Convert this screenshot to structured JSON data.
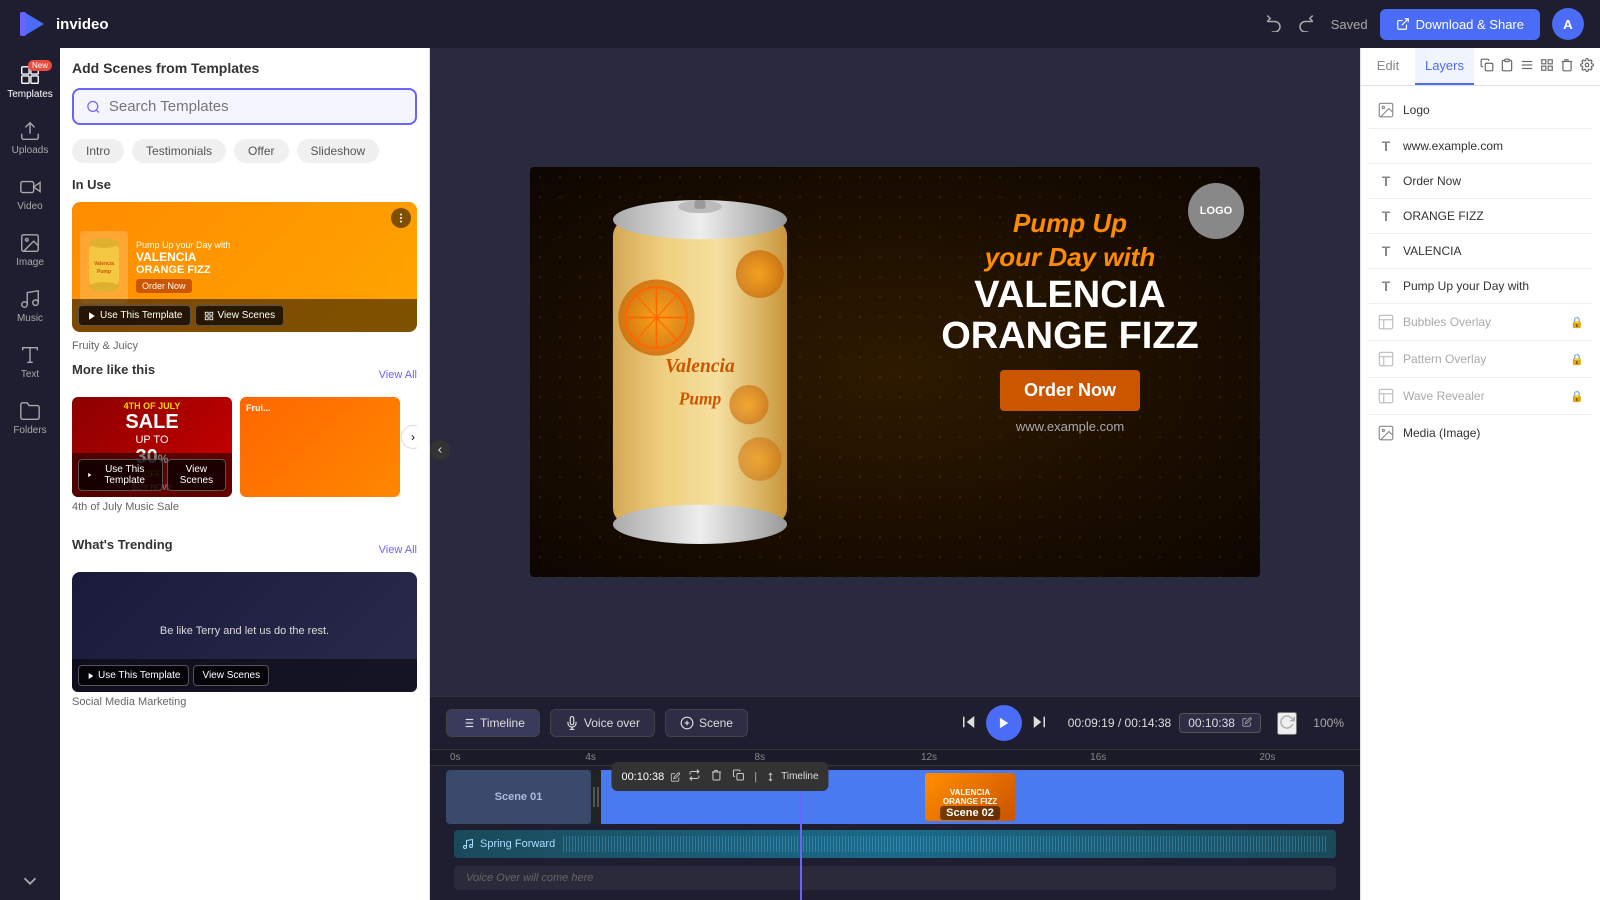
{
  "app": {
    "name": "invideo",
    "saved_status": "Saved"
  },
  "topbar": {
    "download_label": "Download & Share",
    "avatar_label": "A"
  },
  "sidebar_icons": [
    {
      "id": "templates",
      "label": "Templates",
      "badge": "New"
    },
    {
      "id": "uploads",
      "label": "Uploads"
    },
    {
      "id": "video",
      "label": "Video"
    },
    {
      "id": "image",
      "label": "Image"
    },
    {
      "id": "music",
      "label": "Music"
    },
    {
      "id": "text",
      "label": "Text"
    },
    {
      "id": "folders",
      "label": "Folders"
    },
    {
      "id": "more",
      "label": ""
    }
  ],
  "sidebar": {
    "header": "Add Scenes from Templates",
    "search_placeholder": "Search Templates",
    "filters": [
      "Intro",
      "Testimonials",
      "Offer",
      "Slideshow"
    ],
    "in_use_label": "In Use",
    "template_name": "Fruity & Juicy",
    "use_template_btn": "Use This Template",
    "view_scenes_btn": "View Scenes",
    "more_like_label": "More like this",
    "view_all_label": "View All",
    "sale_template_name": "4th of July Music Sale",
    "trending_label": "What's Trending",
    "trending_view_all": "View All",
    "trending_template_name": "Social Media Marketing",
    "trending_desc": "Be like Terry and let us do the rest.",
    "trending_view_scenes": "View Scenes",
    "trending_use_template": "Use This Template"
  },
  "canvas": {
    "logo_text": "LOGO",
    "headline1": "Pump Up",
    "headline2": "your Day with",
    "brand1": "VALENCIA",
    "brand2": "ORANGE FIZZ",
    "cta_btn": "Order Now",
    "website": "www.example.com",
    "can_label": "Valencia Pump"
  },
  "right_panel": {
    "edit_tab": "Edit",
    "layers_tab": "Layers",
    "layers": [
      {
        "id": "logo",
        "name": "Logo",
        "type": "image",
        "locked": false
      },
      {
        "id": "website",
        "name": "www.example.com",
        "type": "text",
        "locked": false
      },
      {
        "id": "order",
        "name": "Order Now",
        "type": "text",
        "locked": false
      },
      {
        "id": "orange_fizz",
        "name": "ORANGE FIZZ",
        "type": "text",
        "locked": false
      },
      {
        "id": "valencia",
        "name": "VALENCIA",
        "type": "text",
        "locked": false
      },
      {
        "id": "pump_day",
        "name": "Pump Up your Day with",
        "type": "text",
        "locked": false
      },
      {
        "id": "bubbles",
        "name": "Bubbles Overlay",
        "type": "overlay",
        "locked": true
      },
      {
        "id": "pattern",
        "name": "Pattern Overlay",
        "type": "overlay",
        "locked": true
      },
      {
        "id": "wave",
        "name": "Wave Revealer",
        "type": "overlay",
        "locked": true
      },
      {
        "id": "media",
        "name": "Media (Image)",
        "type": "image",
        "locked": false
      }
    ]
  },
  "timeline": {
    "timeline_label": "Timeline",
    "voiceover_label": "Voice over",
    "scene_label": "Scene",
    "time_elapsed": "00:09:19",
    "time_total": "00:14:38",
    "time_current": "00:10:38",
    "zoom_level": "100%",
    "scene1_label": "Scene 01",
    "scene2_label": "Scene 02",
    "audio_track_name": "Spring Forward",
    "voiceover_placeholder": "Voice Over will come here",
    "popup_time": "00:10:38",
    "popup_timeline": "Timeline",
    "ruler_labels": [
      "0s",
      "4s",
      "8s",
      "12s",
      "16s",
      "20s"
    ]
  }
}
